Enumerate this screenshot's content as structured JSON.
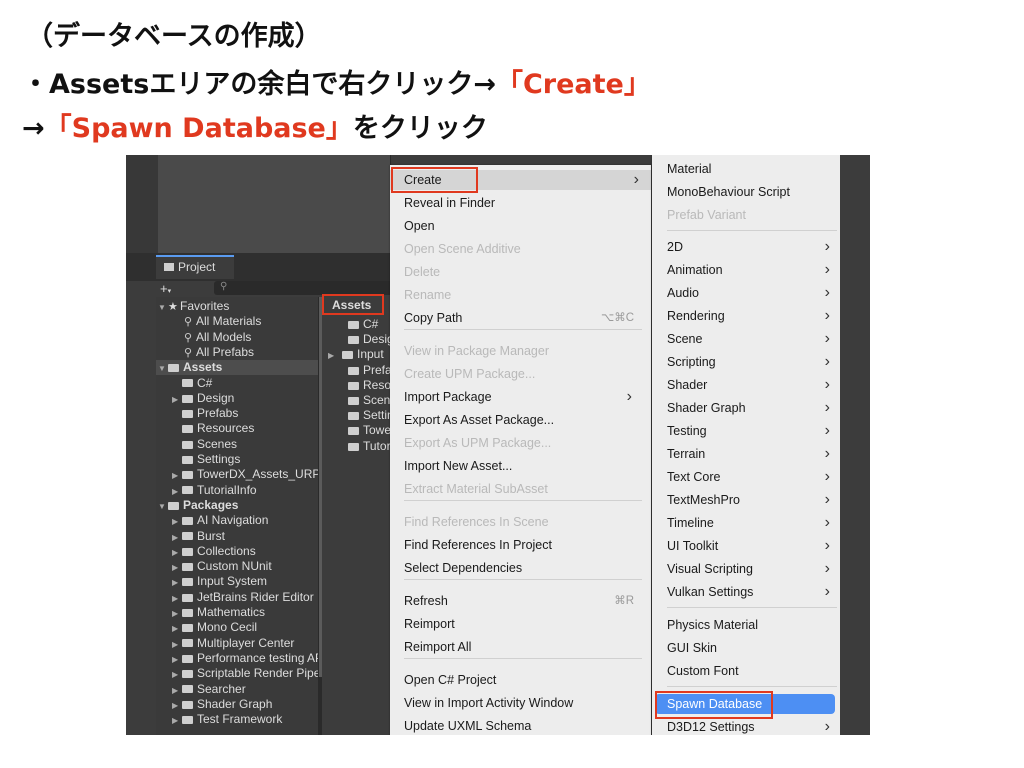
{
  "slide": {
    "line1": "（データベースの作成）",
    "line2_prefix": "・Assetsエリアの余白で右クリック→",
    "line2_highlight": "「Create」",
    "line3_prefix": "→",
    "line3_highlight": "「Spawn Database」",
    "line3_suffix": "をクリック",
    "highlight_color": "#e0391f"
  },
  "project": {
    "tab_label": "Project",
    "plus_label": "+",
    "search_icon": "search-icon",
    "favorites": {
      "label": "Favorites",
      "items": [
        "All Materials",
        "All Models",
        "All Prefabs"
      ]
    },
    "assets": {
      "label": "Assets",
      "items": [
        "C#",
        "Design",
        "Prefabs",
        "Resources",
        "Scenes",
        "Settings",
        "TowerDX_Assets_URP",
        "TutorialInfo"
      ]
    },
    "packages": {
      "label": "Packages",
      "items": [
        "AI Navigation",
        "Burst",
        "Collections",
        "Custom NUnit",
        "Input System",
        "JetBrains Rider Editor",
        "Mathematics",
        "Mono Cecil",
        "Multiplayer Center",
        "Performance testing API",
        "Scriptable Render Pipeline",
        "Searcher",
        "Shader Graph",
        "Test Framework"
      ]
    },
    "grid": {
      "breadcrumb": "Assets",
      "items": [
        "C#",
        "Design",
        "Input",
        "Prefabs",
        "Resources",
        "Scenes",
        "Settings",
        "Tower",
        "Tutorial"
      ]
    }
  },
  "context_menu": {
    "items": [
      {
        "label": "Create",
        "submenu": true
      },
      {
        "label": "Reveal in Finder"
      },
      {
        "label": "Open"
      },
      {
        "label": "Open Scene Additive",
        "disabled": true
      },
      {
        "label": "Delete",
        "disabled": true
      },
      {
        "label": "Rename",
        "disabled": true
      },
      {
        "label": "Copy Path",
        "shortcut": "⌥⌘C"
      },
      {
        "label": "View in Package Manager",
        "disabled": true
      },
      {
        "label": "Create UPM Package...",
        "disabled": true
      },
      {
        "label": "Import Package",
        "submenu": true
      },
      {
        "label": "Export As Asset Package..."
      },
      {
        "label": "Export As UPM Package...",
        "disabled": true
      },
      {
        "label": "Import New Asset..."
      },
      {
        "label": "Extract Material SubAsset",
        "disabled": true
      },
      {
        "label": "Find References In Scene",
        "disabled": true
      },
      {
        "label": "Find References In Project"
      },
      {
        "label": "Select Dependencies"
      },
      {
        "label": "Refresh",
        "shortcut": "⌘R"
      },
      {
        "label": "Reimport"
      },
      {
        "label": "Reimport All"
      },
      {
        "label": "Open C# Project"
      },
      {
        "label": "View in Import Activity Window"
      },
      {
        "label": "Update UXML Schema"
      }
    ]
  },
  "create_submenu": {
    "items": [
      {
        "label": "Material"
      },
      {
        "label": "MonoBehaviour Script"
      },
      {
        "label": "Prefab Variant",
        "disabled": true
      },
      {
        "label": "2D",
        "submenu": true
      },
      {
        "label": "Animation",
        "submenu": true
      },
      {
        "label": "Audio",
        "submenu": true
      },
      {
        "label": "Rendering",
        "submenu": true
      },
      {
        "label": "Scene",
        "submenu": true
      },
      {
        "label": "Scripting",
        "submenu": true
      },
      {
        "label": "Shader",
        "submenu": true
      },
      {
        "label": "Shader Graph",
        "submenu": true
      },
      {
        "label": "Testing",
        "submenu": true
      },
      {
        "label": "Terrain",
        "submenu": true
      },
      {
        "label": "Text Core",
        "submenu": true
      },
      {
        "label": "TextMeshPro",
        "submenu": true
      },
      {
        "label": "Timeline",
        "submenu": true
      },
      {
        "label": "UI Toolkit",
        "submenu": true
      },
      {
        "label": "Visual Scripting",
        "submenu": true
      },
      {
        "label": "Vulkan Settings",
        "submenu": true
      },
      {
        "label": "Physics Material"
      },
      {
        "label": "GUI Skin"
      },
      {
        "label": "Custom Font"
      },
      {
        "label": "Spawn Database",
        "selected": true
      },
      {
        "label": "D3D12 Settings",
        "submenu": true
      }
    ],
    "selected_color": "#4d8ff3"
  }
}
